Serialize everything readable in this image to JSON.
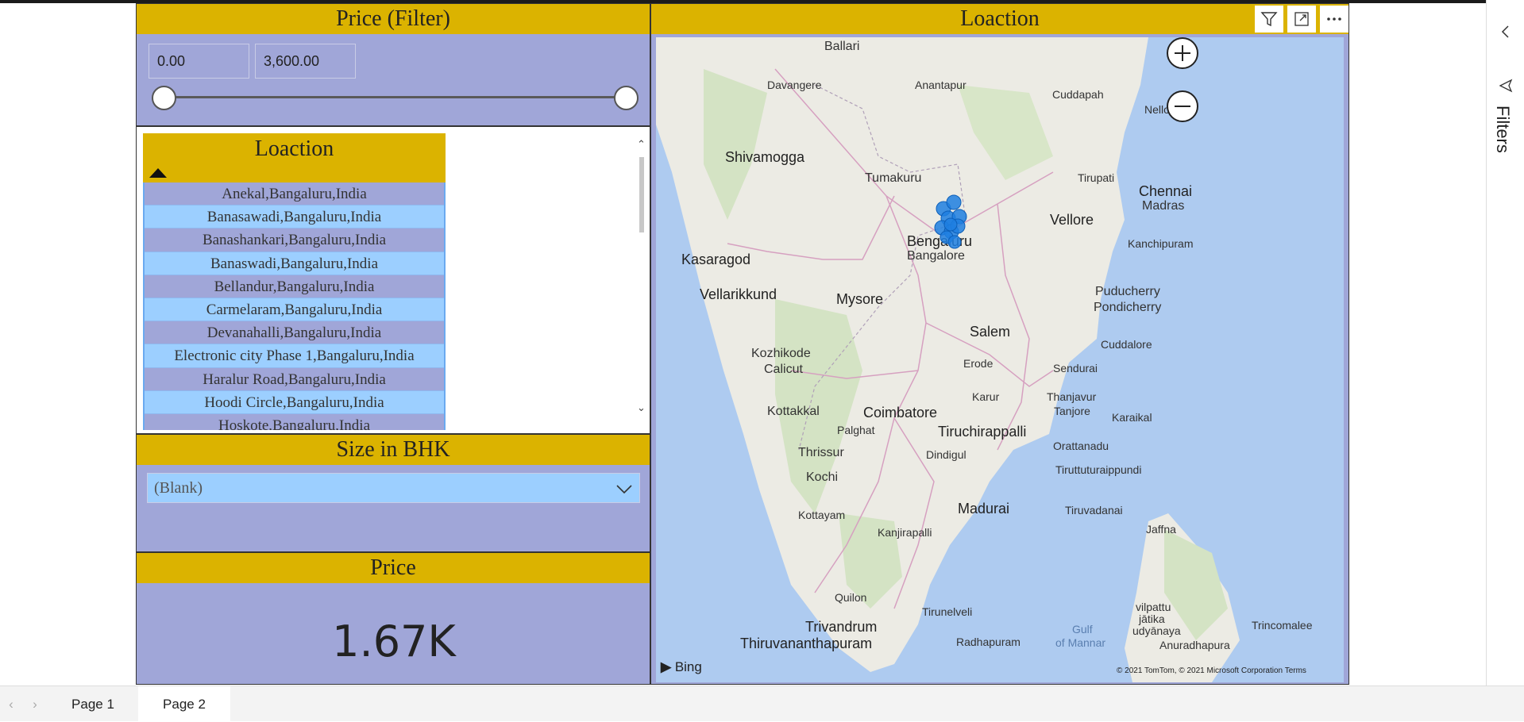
{
  "price_filter": {
    "title": "Price (Filter)",
    "min_value": "0.00",
    "max_value": "3,600.00",
    "slider_min_fraction": 0.0,
    "slider_max_fraction": 1.0
  },
  "location_slicer": {
    "title": "Loaction",
    "items": [
      "Anekal,Bangaluru,India",
      "Banasawadi,Bangaluru,India",
      "Banashankari,Bangaluru,India",
      "Banaswadi,Bangaluru,India",
      "Bellandur,Bangaluru,India",
      "Carmelaram,Bangaluru,India",
      "Devanahalli,Bangaluru,India",
      "Electronic city Phase 1,Bangaluru,India",
      "Haralur Road,Bangaluru,India",
      "Hoodi Circle,Bangaluru,India",
      "Hoskote,Bangaluru,India"
    ]
  },
  "bhk": {
    "title": "Size in BHK",
    "selected": "(Blank)"
  },
  "price_card": {
    "title": "Price",
    "value": "1.67K"
  },
  "map": {
    "title": "Loaction",
    "bing_label": "Bing",
    "copyright": "© 2021 TomTom, © 2021 Microsoft Corporation  Terms",
    "cities": {
      "ballari": "Ballari",
      "davangere": "Davangere",
      "anantapur": "Anantapur",
      "cuddapah": "Cuddapah",
      "nellore": "Nellore",
      "shivamogga": "Shivamogga",
      "tumakuru": "Tumakuru",
      "tirupati": "Tirupati",
      "chennai": "Chennai",
      "madras": "Madras",
      "bengaluru": "Bengaluru",
      "bangalore": "Bangalore",
      "vellore": "Vellore",
      "kanchipuram": "Kanchipuram",
      "kasaragod": "Kasaragod",
      "vellarikkund": "Vellarikkund",
      "mysore": "Mysore",
      "puducherry": "Puducherry",
      "pondicherry": "Pondicherry",
      "salem": "Salem",
      "kozhikode": "Kozhikode",
      "calicut": "Calicut",
      "cuddalore": "Cuddalore",
      "erode": "Erode",
      "sendurai": "Sendurai",
      "karur": "Karur",
      "thanjavur": "Thanjavur",
      "tanjore": "Tanjore",
      "kottakkal": "Kottakkal",
      "coimbatore": "Coimbatore",
      "karaikal": "Karaikal",
      "palghat": "Palghat",
      "tiruchirappalli": "Tiruchirappalli",
      "thrissur": "Thrissur",
      "dindigul": "Dindigul",
      "orattanadu": "Orattanadu",
      "tiruttur": "Tiruttuturaippundi",
      "kochi": "Kochi",
      "madurai": "Madurai",
      "tiruvadanai": "Tiruvadanai",
      "kottayam": "Kottayam",
      "kanjirapalli": "Kanjirapalli",
      "jaffna": "Jaffna",
      "quilon": "Quilon",
      "vilpattu": "vilpattu",
      "jatika": "jātika",
      "udyanaya": "udyānaya",
      "trivandrum": "Trivandrum",
      "thiruvananthapuram": "Thiruvananthapuram",
      "tirunelveli": "Tirunelveli",
      "radhapuram": "Radhapuram",
      "gulf": "Gulf",
      "of_mannar": "of Mannar",
      "anuradhapura": "Anuradhapura",
      "trincomalee": "Trincomalee"
    }
  },
  "filters_pane": {
    "label": "Filters"
  },
  "tabs": [
    "Page 1",
    "Page 2"
  ],
  "active_tab": "Page 2",
  "colors": {
    "header_gold": "#dbb300",
    "panel_lavender": "#a0a6d8",
    "row_blue": "#9ccfff",
    "map_water": "#aecbf0",
    "marker_blue": "#1f7fe0"
  }
}
